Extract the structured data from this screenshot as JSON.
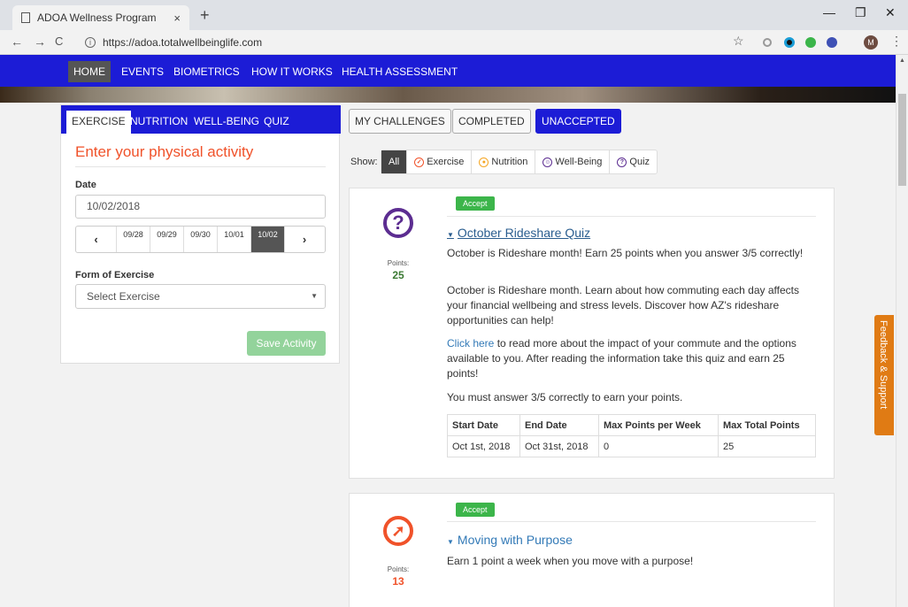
{
  "browser": {
    "tab_title": "ADOA Wellness Program",
    "tab_close": "×",
    "new_tab": "+",
    "url": "https://adoa.totalwellbeinglife.com",
    "avatar_initial": "M"
  },
  "sitenav": {
    "items": [
      "HOME",
      "EVENTS",
      "BIOMETRICS",
      "HOW IT WORKS",
      "HEALTH ASSESSMENT"
    ]
  },
  "left_panel": {
    "tabs": [
      "EXERCISE",
      "NUTRITION",
      "WELL-BEING",
      "QUIZ"
    ],
    "heading": "Enter your physical activity",
    "date_label": "Date",
    "date_value": "10/02/2018",
    "days": [
      "09/28",
      "09/29",
      "09/30",
      "10/01",
      "10/02"
    ],
    "form_label": "Form of Exercise",
    "select_value": "Select Exercise",
    "save_label": "Save Activity"
  },
  "challenge_tabs": [
    "MY CHALLENGES",
    "COMPLETED",
    "UNACCEPTED"
  ],
  "filters": {
    "show_label": "Show:",
    "items": [
      "All",
      "Exercise",
      "Nutrition",
      "Well-Being",
      "Quiz"
    ]
  },
  "cards": [
    {
      "accept_label": "Accept",
      "title": "October Rideshare Quiz",
      "points_label": "Points:",
      "points": "25",
      "p1": "October is Rideshare month! Earn 25 points when you answer 3/5 correctly!",
      "p2": "October is Rideshare month. Learn about how commuting each day affects your financial wellbeing and stress levels. Discover how AZ's rideshare opportunities can help!",
      "p3_link": "Click here",
      "p3_rest": " to read more about the impact of your commute and the options available to you. After reading the information take this quiz and earn 25 points!",
      "p4": "You must answer 3/5 correctly to earn your points.",
      "table": {
        "headers": [
          "Start Date",
          "End Date",
          "Max Points per Week",
          "Max Total Points"
        ],
        "row": [
          "Oct 1st, 2018",
          "Oct 31st, 2018",
          "0",
          "25"
        ]
      }
    },
    {
      "accept_label": "Accept",
      "title": "Moving with Purpose",
      "points_label": "Points:",
      "points": "13",
      "p1": "Earn 1 point a week when you move with a purpose!"
    }
  ],
  "feedback_label": "Feedback & Support",
  "colors": {
    "nav_blue": "#1c1cd6",
    "heading_orange": "#f0522a",
    "accept_green": "#3cb54a",
    "quiz_purple": "#5c2d91",
    "exercise_orange": "#f0522a",
    "feedback_orange": "#e07b14"
  },
  "icons": {
    "quiz": "question-circle-icon",
    "exercise": "running-person-icon"
  }
}
